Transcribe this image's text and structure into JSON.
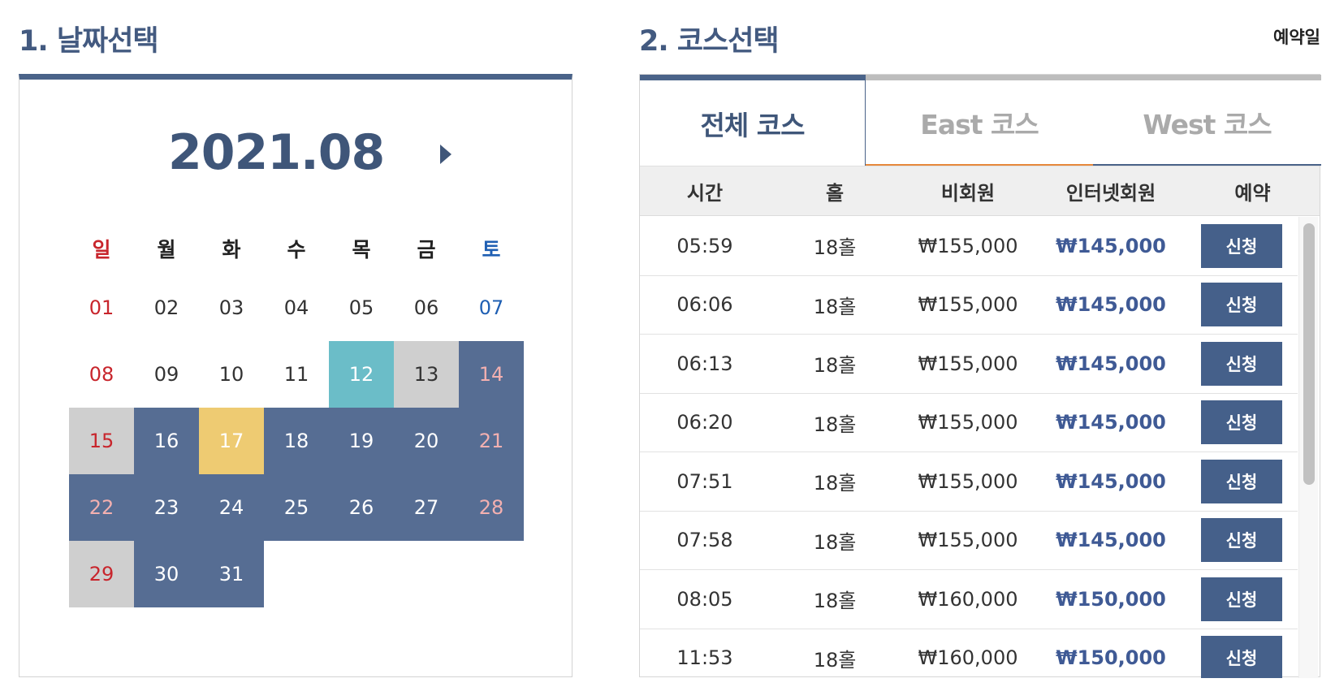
{
  "headers": {
    "date_title": "1. 날짜선택",
    "course_title": "2. 코스선택",
    "reservation_label": "예약일"
  },
  "calendar": {
    "month": "2021.08",
    "weekdays": [
      "일",
      "월",
      "화",
      "수",
      "목",
      "금",
      "토"
    ],
    "weeks": [
      [
        {
          "d": "01",
          "s": "plain"
        },
        {
          "d": "02",
          "s": "plain"
        },
        {
          "d": "03",
          "s": "plain"
        },
        {
          "d": "04",
          "s": "plain"
        },
        {
          "d": "05",
          "s": "plain"
        },
        {
          "d": "06",
          "s": "plain"
        },
        {
          "d": "07",
          "s": "plain"
        }
      ],
      [
        {
          "d": "08",
          "s": "plain"
        },
        {
          "d": "09",
          "s": "plain"
        },
        {
          "d": "10",
          "s": "plain"
        },
        {
          "d": "11",
          "s": "plain"
        },
        {
          "d": "12",
          "s": "today"
        },
        {
          "d": "13",
          "s": "closed"
        },
        {
          "d": "14",
          "s": "avail"
        }
      ],
      [
        {
          "d": "15",
          "s": "closed"
        },
        {
          "d": "16",
          "s": "avail"
        },
        {
          "d": "17",
          "s": "selected"
        },
        {
          "d": "18",
          "s": "avail"
        },
        {
          "d": "19",
          "s": "avail"
        },
        {
          "d": "20",
          "s": "avail"
        },
        {
          "d": "21",
          "s": "avail"
        }
      ],
      [
        {
          "d": "22",
          "s": "avail"
        },
        {
          "d": "23",
          "s": "avail"
        },
        {
          "d": "24",
          "s": "avail"
        },
        {
          "d": "25",
          "s": "avail"
        },
        {
          "d": "26",
          "s": "avail"
        },
        {
          "d": "27",
          "s": "avail"
        },
        {
          "d": "28",
          "s": "avail"
        }
      ],
      [
        {
          "d": "29",
          "s": "closed"
        },
        {
          "d": "30",
          "s": "avail"
        },
        {
          "d": "31",
          "s": "avail"
        },
        {
          "d": "",
          "s": "empty"
        },
        {
          "d": "",
          "s": "empty"
        },
        {
          "d": "",
          "s": "empty"
        },
        {
          "d": "",
          "s": "empty"
        }
      ]
    ]
  },
  "tabs": [
    {
      "label": "전체 코스",
      "active": true
    },
    {
      "label": "East 코스",
      "active": false
    },
    {
      "label": "West 코스",
      "active": false
    }
  ],
  "table": {
    "columns": [
      "시간",
      "홀",
      "비회원",
      "인터넷회원",
      "예약"
    ],
    "apply_label": "신청",
    "rows": [
      {
        "time": "05:59",
        "hole": "18홀",
        "regular": "₩155,000",
        "internet": "₩145,000"
      },
      {
        "time": "06:06",
        "hole": "18홀",
        "regular": "₩155,000",
        "internet": "₩145,000"
      },
      {
        "time": "06:13",
        "hole": "18홀",
        "regular": "₩155,000",
        "internet": "₩145,000"
      },
      {
        "time": "06:20",
        "hole": "18홀",
        "regular": "₩155,000",
        "internet": "₩145,000"
      },
      {
        "time": "07:51",
        "hole": "18홀",
        "regular": "₩155,000",
        "internet": "₩145,000"
      },
      {
        "time": "07:58",
        "hole": "18홀",
        "regular": "₩155,000",
        "internet": "₩145,000"
      },
      {
        "time": "08:05",
        "hole": "18홀",
        "regular": "₩160,000",
        "internet": "₩150,000"
      },
      {
        "time": "11:53",
        "hole": "18홀",
        "regular": "₩160,000",
        "internet": "₩150,000"
      }
    ]
  },
  "colors": {
    "primary": "#4a6389",
    "available": "#566d93",
    "today": "#6bbdc8",
    "selected": "#eecb72",
    "closed": "#cfcfcf",
    "sunday": "#c8252c",
    "saturday": "#1f5fb3",
    "east_tab_accent": "#e6883b"
  },
  "icons": {
    "next_month": "chevron-right-icon"
  }
}
